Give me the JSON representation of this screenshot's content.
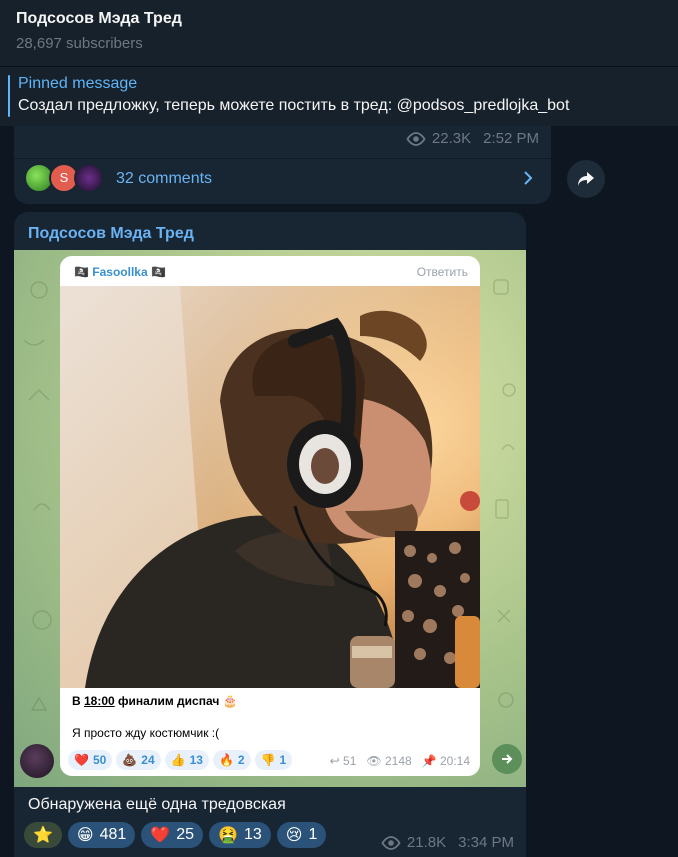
{
  "header": {
    "title": "Подсосов Мэда Тред",
    "subscribers": "28,697 subscribers"
  },
  "pinned": {
    "label": "Pinned message",
    "text": "Создал предложку, теперь можете  постить в тред: @podsos_predlojka_bot"
  },
  "prev_post": {
    "views": "22.3K",
    "time": "2:52 PM",
    "avatar_letter": "S",
    "comments": "32 comments"
  },
  "post": {
    "author": "Подсосов Мэда Тред",
    "forwarded": {
      "sender": "🏴‍☠️ Fasoollka 🏴‍☠️",
      "reply_label": "Ответить",
      "caption_pre": "В ",
      "caption_time": "18:00",
      "caption_post": " финалим диспач 🎂",
      "subtext": "Я просто жду костюмчик :(",
      "reactions": [
        {
          "emoji": "❤️",
          "count": "50"
        },
        {
          "emoji": "💩",
          "count": "24"
        },
        {
          "emoji": "👍",
          "count": "13"
        },
        {
          "emoji": "🔥",
          "count": "2"
        },
        {
          "emoji": "👎",
          "count": "1"
        }
      ],
      "replies": "51",
      "views": "2148",
      "time": "20:14"
    },
    "text": "Обнаружена ещё одна тредовская",
    "reactions": [
      {
        "emoji": "⭐",
        "count": ""
      },
      {
        "emoji": "😁",
        "count": "481"
      },
      {
        "emoji": "❤️",
        "count": "25"
      },
      {
        "emoji": "🤮",
        "count": "13"
      },
      {
        "emoji": "😢",
        "count": "1"
      }
    ],
    "views": "21.8K",
    "time": "3:34 PM"
  }
}
